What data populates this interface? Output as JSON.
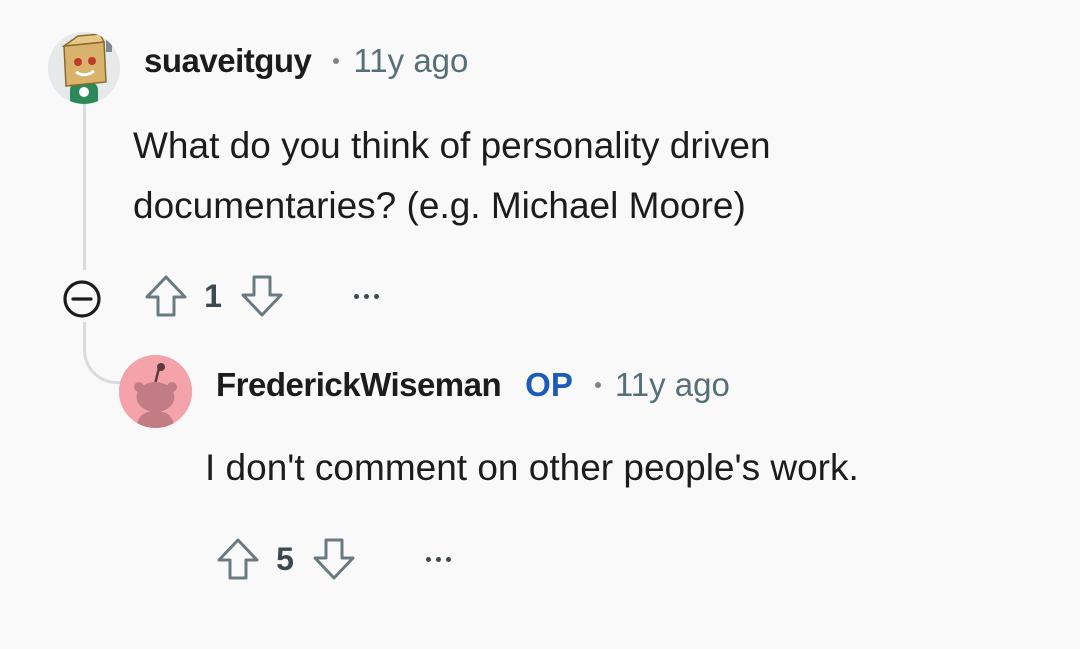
{
  "comment": {
    "username": "suaveitguy",
    "time": "11y ago",
    "body": "What do you think of personality driven documentaries? (e.g. Michael Moore)",
    "score": "1",
    "avatar_icon": "cardboard-box-snoo-avatar-icon"
  },
  "reply": {
    "username": "FrederickWiseman",
    "badge": "OP",
    "time": "11y ago",
    "body": "I don't comment on other people's work.",
    "score": "5",
    "avatar_icon": "default-snoo-avatar-icon"
  },
  "icons": {
    "upvote": "upvote-arrow-icon",
    "downvote": "downvote-arrow-icon",
    "more": "ellipsis-icon",
    "collapse": "collapse-minus-icon"
  },
  "colors": {
    "background": "#f9f9f9",
    "op_badge": "#1d5bb8",
    "thread_line": "#d8dcde",
    "default_avatar": "#f4a3ab"
  }
}
